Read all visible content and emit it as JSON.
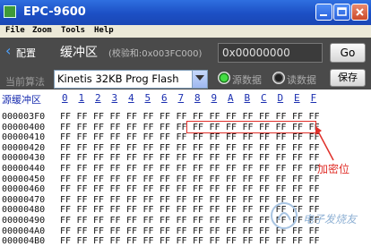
{
  "window": {
    "title": "EPC-9600"
  },
  "menu": [
    "File",
    "Zoom",
    "Tools",
    "Help"
  ],
  "toolbar": {
    "back_label": "配置",
    "buffer_title": "缓冲区",
    "checksum": "(校验和:0x003FC000)",
    "address_value": "0x00000000",
    "go_label": "Go",
    "algo_label": "当前算法",
    "algo_value": "Kinetis 32KB Prog Flash",
    "radio_source": "源数据",
    "radio_read": "读数据",
    "save_label": "保存"
  },
  "hex": {
    "source_label": "源缓冲区",
    "columns": [
      "0",
      "1",
      "2",
      "3",
      "4",
      "5",
      "6",
      "7",
      "8",
      "9",
      "A",
      "B",
      "C",
      "D",
      "E",
      "F"
    ],
    "rows": [
      {
        "address": "000003F0",
        "bytes": [
          "FF",
          "FF",
          "FF",
          "FF",
          "FF",
          "FF",
          "FF",
          "FF",
          "FF",
          "FF",
          "FF",
          "FF",
          "FF",
          "FF",
          "FF",
          "FF"
        ]
      },
      {
        "address": "00000400",
        "bytes": [
          "FF",
          "FF",
          "FF",
          "FF",
          "FF",
          "FF",
          "FF",
          "FF",
          "FF",
          "FF",
          "FF",
          "FF",
          "FF",
          "FF",
          "FF",
          "FF"
        ]
      },
      {
        "address": "00000410",
        "bytes": [
          "FF",
          "FF",
          "FF",
          "FF",
          "FF",
          "FF",
          "FF",
          "FF",
          "FF",
          "FF",
          "FF",
          "FF",
          "FF",
          "FF",
          "FF",
          "FF"
        ]
      },
      {
        "address": "00000420",
        "bytes": [
          "FF",
          "FF",
          "FF",
          "FF",
          "FF",
          "FF",
          "FF",
          "FF",
          "FF",
          "FF",
          "FF",
          "FF",
          "FF",
          "FF",
          "FF",
          "FF"
        ]
      },
      {
        "address": "00000430",
        "bytes": [
          "FF",
          "FF",
          "FF",
          "FF",
          "FF",
          "FF",
          "FF",
          "FF",
          "FF",
          "FF",
          "FF",
          "FF",
          "FF",
          "FF",
          "FF",
          "FF"
        ]
      },
      {
        "address": "00000440",
        "bytes": [
          "FF",
          "FF",
          "FF",
          "FF",
          "FF",
          "FF",
          "FF",
          "FF",
          "FF",
          "FF",
          "FF",
          "FF",
          "FF",
          "FF",
          "FF",
          "FF"
        ]
      },
      {
        "address": "00000450",
        "bytes": [
          "FF",
          "FF",
          "FF",
          "FF",
          "FF",
          "FF",
          "FF",
          "FF",
          "FF",
          "FF",
          "FF",
          "FF",
          "FF",
          "FF",
          "FF",
          "FF"
        ]
      },
      {
        "address": "00000460",
        "bytes": [
          "FF",
          "FF",
          "FF",
          "FF",
          "FF",
          "FF",
          "FF",
          "FF",
          "FF",
          "FF",
          "FF",
          "FF",
          "FF",
          "FF",
          "FF",
          "FF"
        ]
      },
      {
        "address": "00000470",
        "bytes": [
          "FF",
          "FF",
          "FF",
          "FF",
          "FF",
          "FF",
          "FF",
          "FF",
          "FF",
          "FF",
          "FF",
          "FF",
          "FF",
          "FF",
          "FF",
          "FF"
        ]
      },
      {
        "address": "00000480",
        "bytes": [
          "FF",
          "FF",
          "FF",
          "FF",
          "FF",
          "FF",
          "FF",
          "FF",
          "FF",
          "FF",
          "FF",
          "FF",
          "FF",
          "FF",
          "FF",
          "FF"
        ]
      },
      {
        "address": "00000490",
        "bytes": [
          "FF",
          "FF",
          "FF",
          "FF",
          "FF",
          "FF",
          "FF",
          "FF",
          "FF",
          "FF",
          "FF",
          "FF",
          "FF",
          "FF",
          "FF",
          "FF"
        ]
      },
      {
        "address": "000004A0",
        "bytes": [
          "FF",
          "FF",
          "FF",
          "FF",
          "FF",
          "FF",
          "FF",
          "FF",
          "FF",
          "FF",
          "FF",
          "FF",
          "FF",
          "FF",
          "FF",
          "FF"
        ]
      },
      {
        "address": "000004B0",
        "bytes": [
          "FF",
          "FF",
          "FF",
          "FF",
          "FF",
          "FF",
          "FF",
          "FF",
          "FF",
          "FF",
          "FF",
          "FF",
          "FF",
          "FF",
          "FF",
          "FF"
        ]
      }
    ]
  },
  "annotation": {
    "label": "加密位",
    "color": "#e0302a"
  },
  "watermark": "电子发烧友",
  "colors": {
    "titlebar": "#1c4fc4",
    "toolbar": "#4a4a4a",
    "hex_header": "#1b2fb0"
  }
}
